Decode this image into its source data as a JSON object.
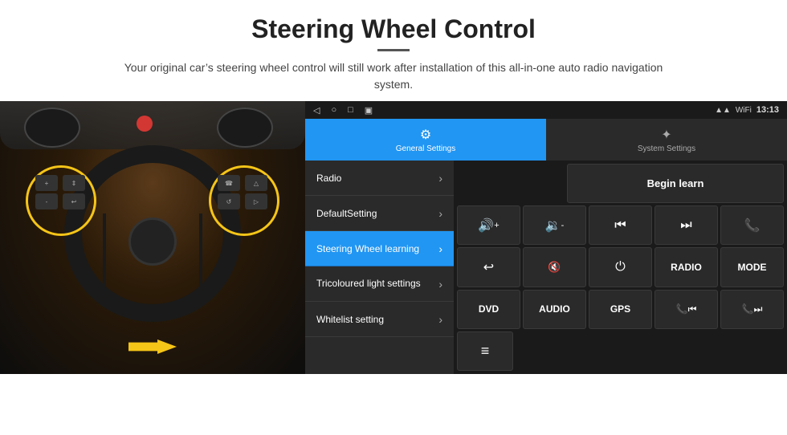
{
  "header": {
    "title": "Steering Wheel Control",
    "divider": true,
    "subtitle": "Your original car’s steering wheel control will still work after installation of this all-in-one auto radio navigation system."
  },
  "status_bar": {
    "time": "13:13",
    "icons": {
      "back": "◁",
      "home": "○",
      "recent": "□",
      "cast": "▣"
    }
  },
  "tabs": [
    {
      "id": "general",
      "label": "General Settings",
      "icon": "⚙",
      "active": true
    },
    {
      "id": "system",
      "label": "System Settings",
      "icon": "★",
      "active": false
    }
  ],
  "menu_items": [
    {
      "id": "radio",
      "label": "Radio",
      "active": false
    },
    {
      "id": "default",
      "label": "DefaultSetting",
      "active": false
    },
    {
      "id": "steering",
      "label": "Steering Wheel learning",
      "active": true
    },
    {
      "id": "tricoloured",
      "label": "Tricoloured light settings",
      "active": false
    },
    {
      "id": "whitelist",
      "label": "Whitelist setting",
      "active": false
    }
  ],
  "buttons": {
    "begin_learn": "Begin learn",
    "grid": [
      [
        {
          "label": "🔊+",
          "icon": true,
          "text": "🔊+"
        },
        {
          "label": "🔈-",
          "icon": true,
          "text": "🔉-"
        },
        {
          "label": "|◀◀",
          "icon": false,
          "text": "⏮"
        },
        {
          "label": "▶▶|",
          "icon": false,
          "text": "⏭"
        },
        {
          "label": "📞",
          "icon": true,
          "text": "☎"
        }
      ],
      [
        {
          "label": "↩",
          "icon": false,
          "text": "↩"
        },
        {
          "label": "🔇x",
          "icon": true,
          "text": "🔇"
        },
        {
          "label": "⏻",
          "icon": false,
          "text": "⏻"
        },
        {
          "label": "RADIO",
          "icon": false,
          "text": "RADIO"
        },
        {
          "label": "MODE",
          "icon": false,
          "text": "MODE"
        }
      ],
      [
        {
          "label": "DVD",
          "icon": false,
          "text": "DVD"
        },
        {
          "label": "AUDIO",
          "icon": false,
          "text": "AUDIO"
        },
        {
          "label": "GPS",
          "icon": false,
          "text": "GPS"
        },
        {
          "label": "📞⏮",
          "icon": true,
          "text": "📞⏮"
        },
        {
          "label": "📞⏭",
          "icon": true,
          "text": "📞⏭"
        }
      ],
      [
        {
          "label": "≡",
          "icon": false,
          "text": "≡"
        }
      ]
    ]
  }
}
